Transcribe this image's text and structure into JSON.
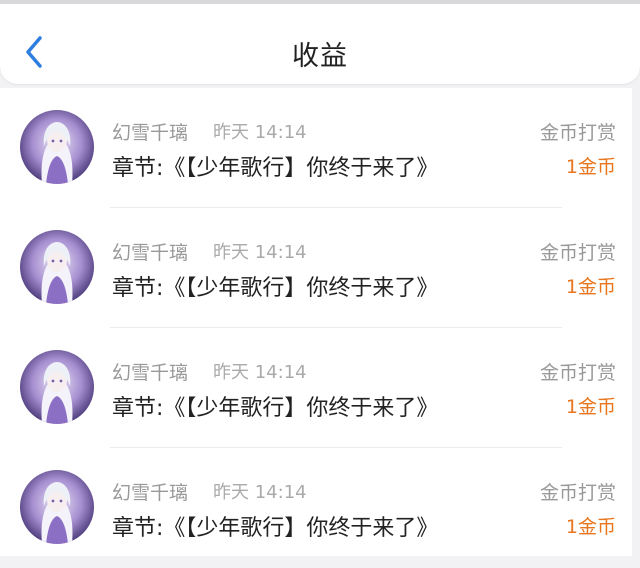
{
  "header": {
    "title": "收益",
    "back_icon": "chevron-left-icon",
    "accent": "#2f7fe0"
  },
  "records": [
    {
      "name": "幻雪千璃",
      "time": "昨天 14:14",
      "chapter": "章节:《【少年歌行】你终于来了》",
      "type": "金币打赏",
      "amount": "1金币"
    },
    {
      "name": "幻雪千璃",
      "time": "昨天 14:14",
      "chapter": "章节:《【少年歌行】你终于来了》",
      "type": "金币打赏",
      "amount": "1金币"
    },
    {
      "name": "幻雪千璃",
      "time": "昨天 14:14",
      "chapter": "章节:《【少年歌行】你终于来了》",
      "type": "金币打赏",
      "amount": "1金币"
    },
    {
      "name": "幻雪千璃",
      "time": "昨天 14:14",
      "chapter": "章节:《【少年歌行】你终于来了》",
      "type": "金币打赏",
      "amount": "1金币"
    }
  ],
  "colors": {
    "amount": "#e8761f",
    "muted": "#999999",
    "text": "#222222"
  }
}
